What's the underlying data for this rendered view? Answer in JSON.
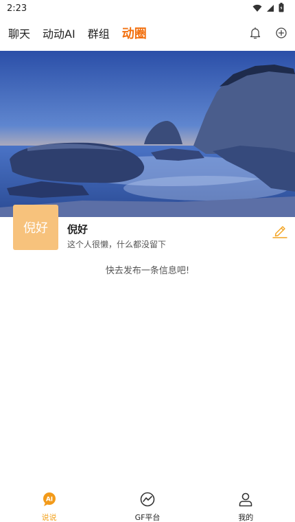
{
  "status_bar": {
    "time": "2:23",
    "icons": [
      "wifi-icon",
      "signal-icon",
      "battery-icon"
    ]
  },
  "header": {
    "tabs": [
      {
        "label": "聊天",
        "active": false
      },
      {
        "label": "动动AI",
        "active": false
      },
      {
        "label": "群组",
        "active": false
      },
      {
        "label": "动圈",
        "active": true
      }
    ],
    "actions": [
      "bell-icon",
      "add-circle-icon"
    ]
  },
  "profile": {
    "avatar_text": "倪好",
    "name": "倪好",
    "bio": "这个人很懒，什么都没留下"
  },
  "empty_hint": "快去发布一条信息吧!",
  "bottom_nav": {
    "items": [
      {
        "label": "说说",
        "icon": "ai-chat-icon",
        "icon_text": "AI",
        "active": true
      },
      {
        "label": "GF平台",
        "icon": "gauge-icon",
        "active": false
      },
      {
        "label": "我的",
        "icon": "user-icon",
        "active": false
      }
    ]
  },
  "colors": {
    "accent": "#f2700f",
    "avatar_bg": "#f7c27c",
    "nav_active": "#f2a21f"
  }
}
